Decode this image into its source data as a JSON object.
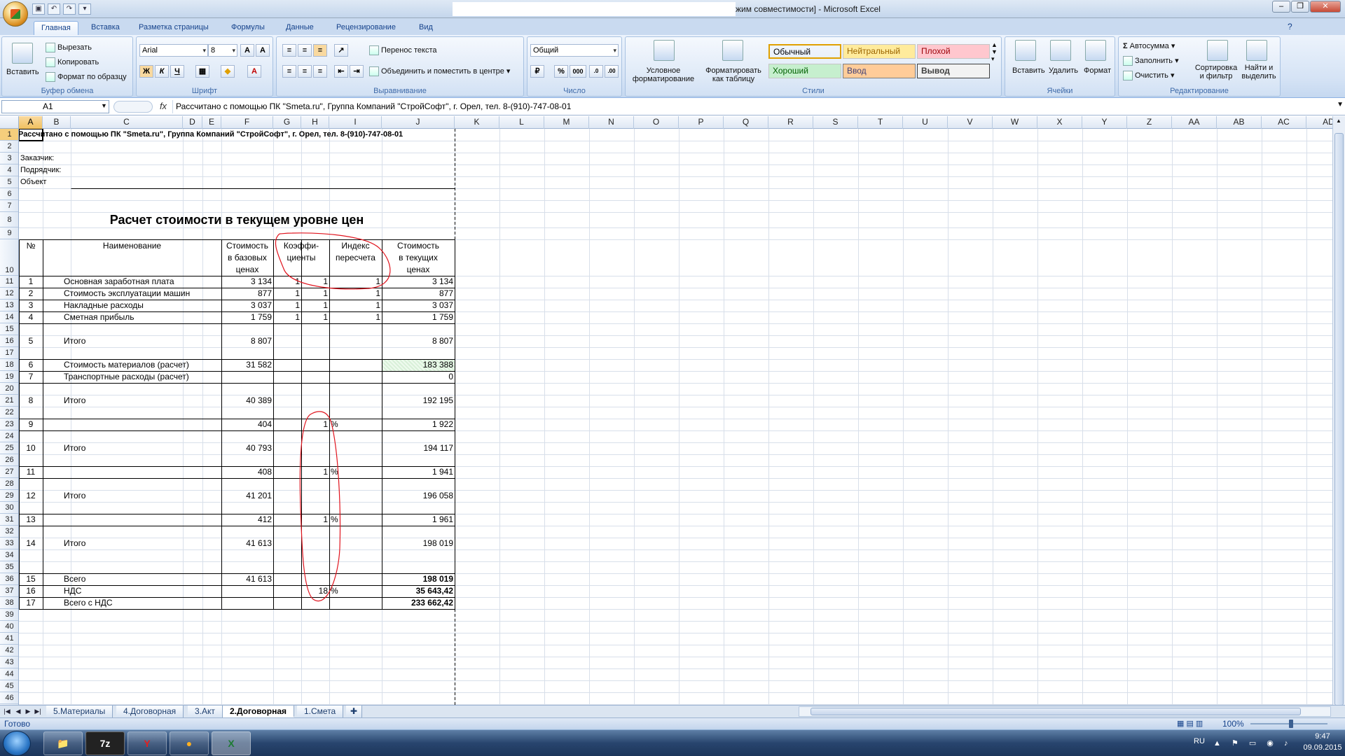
{
  "window": {
    "title": "жим совместимости] - Microsoft Excel",
    "qat": [
      "save-icon",
      "undo-icon",
      "redo-icon",
      "customize-icon"
    ]
  },
  "ribbon": {
    "tabs": [
      "Главная",
      "Вставка",
      "Разметка страницы",
      "Формулы",
      "Данные",
      "Рецензирование",
      "Вид"
    ],
    "clipboard": {
      "paste": "Вставить",
      "cut": "Вырезать",
      "copy": "Копировать",
      "format_painter": "Формат по образцу",
      "label": "Буфер обмена"
    },
    "font": {
      "name": "Arial",
      "size": "8",
      "bold": "Ж",
      "italic": "К",
      "underline": "Ч",
      "label": "Шрифт"
    },
    "alignment": {
      "wrap": "Перенос текста",
      "merge": "Объединить и поместить в центре",
      "label": "Выравнивание"
    },
    "number": {
      "format": "Общий",
      "percent": "%",
      "thousands": "000",
      "label": "Число"
    },
    "styles": {
      "conditional": "Условное форматирование",
      "as_table": "Форматировать как таблицу",
      "items": [
        {
          "name": "Обычный",
          "bg": "#ffffff",
          "color": "#000000"
        },
        {
          "name": "Нейтральный",
          "bg": "#ffeb9c",
          "color": "#9c6500"
        },
        {
          "name": "Плохой",
          "bg": "#ffc7ce",
          "color": "#9c0006"
        },
        {
          "name": "Хороший",
          "bg": "#c6efce",
          "color": "#006100"
        },
        {
          "name": "Ввод",
          "bg": "#ffcc99",
          "color": "#3f3f76"
        },
        {
          "name": "Вывод",
          "bg": "#f2f2f2",
          "color": "#3f3f3f"
        }
      ],
      "label": "Стили"
    },
    "cells": {
      "insert": "Вставить",
      "delete": "Удалить",
      "format": "Формат",
      "label": "Ячейки"
    },
    "editing": {
      "autosum": "Автосумма",
      "fill": "Заполнить",
      "clear": "Очистить",
      "sort": "Сортировка и фильтр",
      "find": "Найти и выделить",
      "label": "Редактирование"
    }
  },
  "formula_bar": {
    "name_box": "A1",
    "fx": "fx",
    "formula": "Рассчитано с помощью ПК \"Smeta.ru\", Группа Компаний \"СтройСофт\", г. Орел, тел. 8-(910)-747-08-01"
  },
  "columns": [
    "A",
    "B",
    "C",
    "D",
    "E",
    "F",
    "G",
    "H",
    "I",
    "J",
    "K",
    "L",
    "M",
    "N",
    "O",
    "P",
    "Q",
    "R",
    "S",
    "T",
    "U",
    "V",
    "W",
    "X",
    "Y",
    "Z",
    "AA",
    "AB",
    "AC",
    "AD"
  ],
  "sheet": {
    "row1": "Рассчитано с помощью ПК \"Smeta.ru\", Группа Компаний \"СтройСофт\", г. Орел, тел. 8-(910)-747-08-01",
    "customer": "Заказчик:",
    "contractor": "Подрядчик:",
    "object": "Объект",
    "title": "Расчет стоимости в текущем уровне цен",
    "headers": {
      "num": "№",
      "name": "Наименование",
      "base_cost": [
        "Стоимость",
        "в базовых",
        "ценах"
      ],
      "coef": [
        "Коэффи-",
        "циенты"
      ],
      "index": [
        "Индекс",
        "пересчета"
      ],
      "current_cost": [
        "Стоимость",
        "в текущих",
        "ценах"
      ]
    },
    "rows": [
      {
        "row": 11,
        "num": "1",
        "name": "Основная заработная плата",
        "base": "3 134",
        "g": "1",
        "h": "1",
        "i": "1",
        "cur": "3 134"
      },
      {
        "row": 12,
        "num": "2",
        "name": "Стоимость эксплуатации машин",
        "base": "877",
        "g": "1",
        "h": "1",
        "i": "1",
        "cur": "877"
      },
      {
        "row": 13,
        "num": "3",
        "name": "Накладные расходы",
        "base": "3 037",
        "g": "1",
        "h": "1",
        "i": "1",
        "cur": "3 037"
      },
      {
        "row": 14,
        "num": "4",
        "name": "Сметная прибыль",
        "base": "1 759",
        "g": "1",
        "h": "1",
        "i": "1",
        "cur": "1 759"
      },
      {
        "row": 16,
        "num": "5",
        "name": "Итого",
        "base": "8 807",
        "g": "",
        "h": "",
        "i": "",
        "cur": "8 807"
      },
      {
        "row": 18,
        "num": "6",
        "name": "Стоимость материалов (расчет)",
        "base": "31 582",
        "g": "",
        "h": "",
        "i": "",
        "cur": "183 388"
      },
      {
        "row": 19,
        "num": "7",
        "name": "Транспортные расходы (расчет)",
        "base": "",
        "g": "",
        "h": "",
        "i": "",
        "cur": "0"
      },
      {
        "row": 21,
        "num": "8",
        "name": "Итого",
        "base": "40 389",
        "g": "",
        "h": "",
        "i": "",
        "cur": "192 195"
      },
      {
        "row": 23,
        "num": "9",
        "name": "",
        "base": "404",
        "g": "",
        "h": "1",
        "i": "%",
        "cur": "1 922"
      },
      {
        "row": 25,
        "num": "10",
        "name": "Итого",
        "base": "40 793",
        "g": "",
        "h": "",
        "i": "",
        "cur": "194 117"
      },
      {
        "row": 27,
        "num": "11",
        "name": "",
        "base": "408",
        "g": "",
        "h": "1",
        "i": "%",
        "cur": "1 941"
      },
      {
        "row": 29,
        "num": "12",
        "name": "Итого",
        "base": "41 201",
        "g": "",
        "h": "",
        "i": "",
        "cur": "196 058"
      },
      {
        "row": 31,
        "num": "13",
        "name": "",
        "base": "412",
        "g": "",
        "h": "1",
        "i": "%",
        "cur": "1 961"
      },
      {
        "row": 33,
        "num": "14",
        "name": "Итого",
        "base": "41 613",
        "g": "",
        "h": "",
        "i": "",
        "cur": "198 019"
      },
      {
        "row": 36,
        "num": "15",
        "name": "Всего",
        "base": "41 613",
        "g": "",
        "h": "",
        "i": "",
        "cur": "198 019",
        "bold": true
      },
      {
        "row": 37,
        "num": "16",
        "name": "НДС",
        "base": "",
        "g": "",
        "h": "18",
        "i": "%",
        "cur": "35 643,42",
        "bold": true
      },
      {
        "row": 38,
        "num": "17",
        "name": "Всего с НДС",
        "base": "",
        "g": "",
        "h": "",
        "i": "",
        "cur": "233 662,42",
        "bold": true
      }
    ]
  },
  "sheet_tabs": [
    "5.Материалы",
    "4.Договорная",
    "3.Акт",
    "2.Договорная",
    "1.Смета"
  ],
  "active_tab": "2.Договорная",
  "status": {
    "ready": "Готово",
    "zoom": "100%"
  },
  "taskbar": {
    "apps": [
      "explorer-icon",
      "7zip-icon",
      "yandex-icon",
      "paint-icon",
      "excel-icon"
    ],
    "lang": "RU",
    "time": "9:47",
    "date": "09.09.2015"
  },
  "colors": {
    "accent": "#15428b",
    "annotation": "#e0141e",
    "selected_header": "#f5ce7c"
  }
}
